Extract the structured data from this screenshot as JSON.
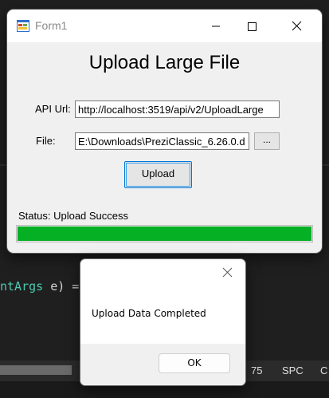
{
  "form": {
    "title": "Form1",
    "heading": "Upload Large File",
    "api_url_label": "API Url:",
    "api_url_value": "http://localhost:3519/api/v2/UploadLarge",
    "file_label": "File:",
    "file_value": "E:\\Downloads\\PreziClassic_6.26.0.d",
    "browse_label": "...",
    "upload_label": "Upload",
    "status_text": "Status: Upload Success",
    "progress_fraction": 1.0,
    "progress_color": "#06b025"
  },
  "editor": {
    "code_partial_type": "ntArgs",
    "code_rest": " e) ="
  },
  "statusbar": {
    "item_75": "75",
    "item_spc": "SPC",
    "item_c": "C"
  },
  "message_box": {
    "text": "Upload Data Completed",
    "ok_label": "OK"
  }
}
